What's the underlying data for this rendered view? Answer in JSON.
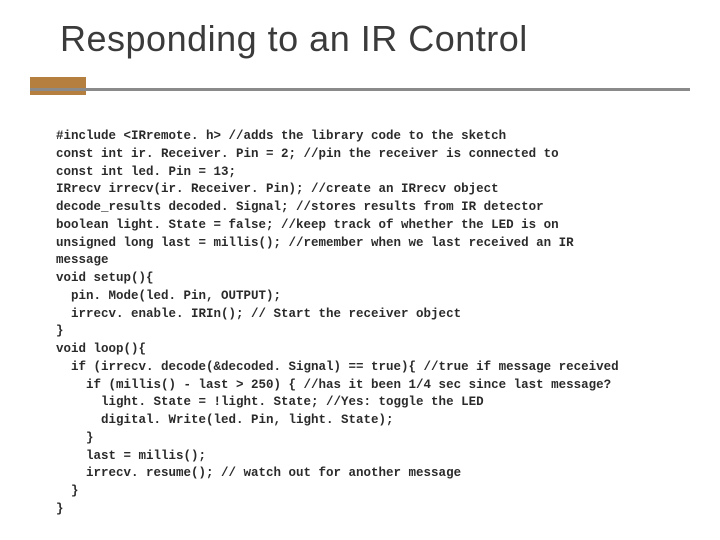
{
  "title": "Responding to an IR Control",
  "code_lines": [
    "#include <IRremote. h> //adds the library code to the sketch",
    "const int ir. Receiver. Pin = 2; //pin the receiver is connected to",
    "const int led. Pin = 13;",
    "IRrecv irrecv(ir. Receiver. Pin); //create an IRrecv object",
    "decode_results decoded. Signal; //stores results from IR detector",
    "boolean light. State = false; //keep track of whether the LED is on",
    "unsigned long last = millis(); //remember when we last received an IR",
    "message",
    "void setup(){",
    "  pin. Mode(led. Pin, OUTPUT);",
    "  irrecv. enable. IRIn(); // Start the receiver object",
    "}",
    "void loop(){",
    "  if (irrecv. decode(&decoded. Signal) == true){ //true if message received",
    "    if (millis() - last > 250) { //has it been 1/4 sec since last message?",
    "      light. State = !light. State; //Yes: toggle the LED",
    "      digital. Write(led. Pin, light. State);",
    "    }",
    "    last = millis();",
    "    irrecv. resume(); // watch out for another message",
    "  }",
    "}"
  ]
}
